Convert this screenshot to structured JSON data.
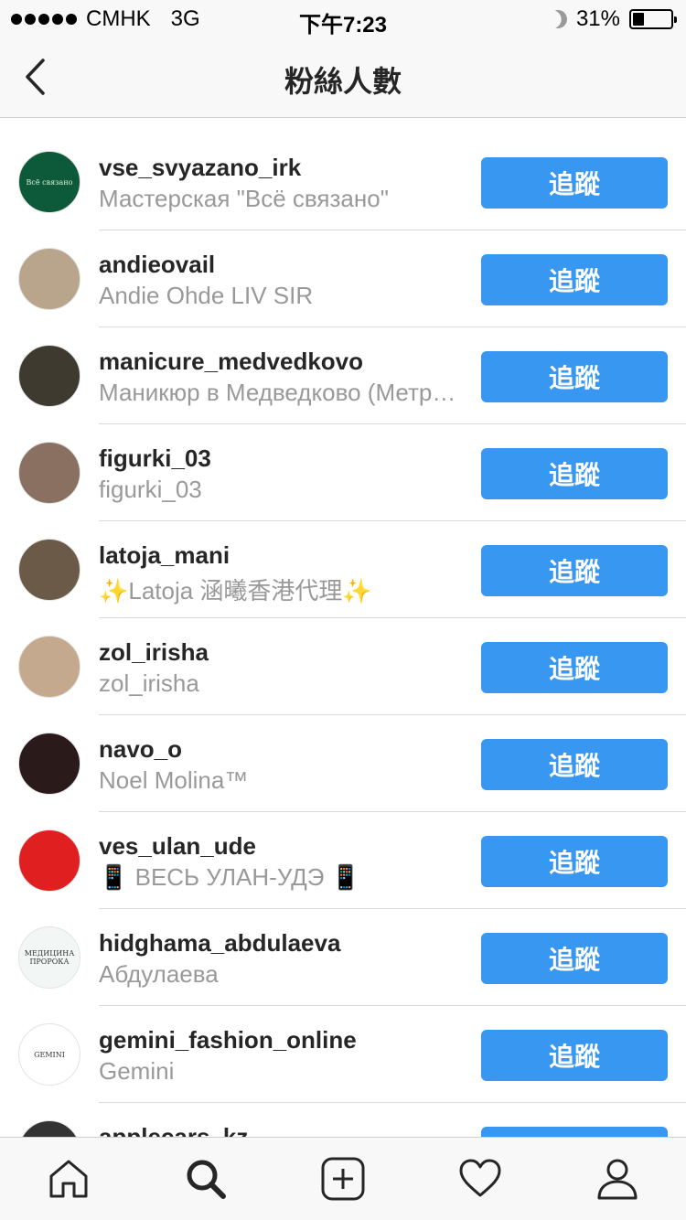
{
  "status_bar": {
    "carrier": "CMHK",
    "network": "3G",
    "time": "下午7:23",
    "battery_text": "31%",
    "battery_level": 0.31
  },
  "nav": {
    "title": "粉絲人數",
    "back_icon": "chevron-left-icon"
  },
  "followers": [
    {
      "username": "vse_svyazano_irk",
      "full_name": "Мастерская \"Всё связано\"",
      "button": "追蹤",
      "avatar_color": "#0c5a3a",
      "avatar_text": "Всё связано"
    },
    {
      "username": "andieovail",
      "full_name": "Andie Ohde LIV SIR",
      "button": "追蹤",
      "avatar_color": "#b9a58c",
      "avatar_text": ""
    },
    {
      "username": "manicure_medvedkovo",
      "full_name": "Маникюр в Медведково (Метро Медведково)",
      "button": "追蹤",
      "avatar_color": "#3f3a30",
      "avatar_text": ""
    },
    {
      "username": "figurki_03",
      "full_name": "figurki_03",
      "button": "追蹤",
      "avatar_color": "#8a7060",
      "avatar_text": ""
    },
    {
      "username": "latoja_mani",
      "full_name": "✨Latoja 涵曦香港代理✨",
      "button": "追蹤",
      "avatar_color": "#6b5a48",
      "avatar_text": ""
    },
    {
      "username": "zol_irisha",
      "full_name": "zol_irisha",
      "button": "追蹤",
      "avatar_color": "#c4a98e",
      "avatar_text": ""
    },
    {
      "username": "navo_o",
      "full_name": "Noel Molina™",
      "button": "追蹤",
      "avatar_color": "#2a1a1a",
      "avatar_text": ""
    },
    {
      "username": "ves_ulan_ude",
      "full_name": "📱 ВЕСЬ УЛАН-УДЭ 📱",
      "button": "追蹤",
      "avatar_color": "#e02020",
      "avatar_text": ""
    },
    {
      "username": "hidghama_abdulaeva",
      "full_name": "Абдулаева",
      "button": "追蹤",
      "avatar_color": "#f2f7f5",
      "avatar_text": "МЕДИЦИНА ПРОРОКА"
    },
    {
      "username": "gemini_fashion_online",
      "full_name": "Gemini",
      "button": "追蹤",
      "avatar_color": "#ffffff",
      "avatar_text": "GEMINI"
    },
    {
      "username": "applecars_kz",
      "full_name": "",
      "button": "追蹤",
      "avatar_color": "#333333",
      "avatar_text": ""
    }
  ],
  "tab_bar": {
    "tabs": [
      {
        "name": "home-icon",
        "active": false
      },
      {
        "name": "search-icon",
        "active": true
      },
      {
        "name": "add-post-icon",
        "active": false
      },
      {
        "name": "heart-icon",
        "active": false
      },
      {
        "name": "profile-icon",
        "active": false
      }
    ]
  },
  "colors": {
    "accent": "#3897f0",
    "bar_background": "#f8f8f8",
    "secondary_text": "#999999"
  }
}
